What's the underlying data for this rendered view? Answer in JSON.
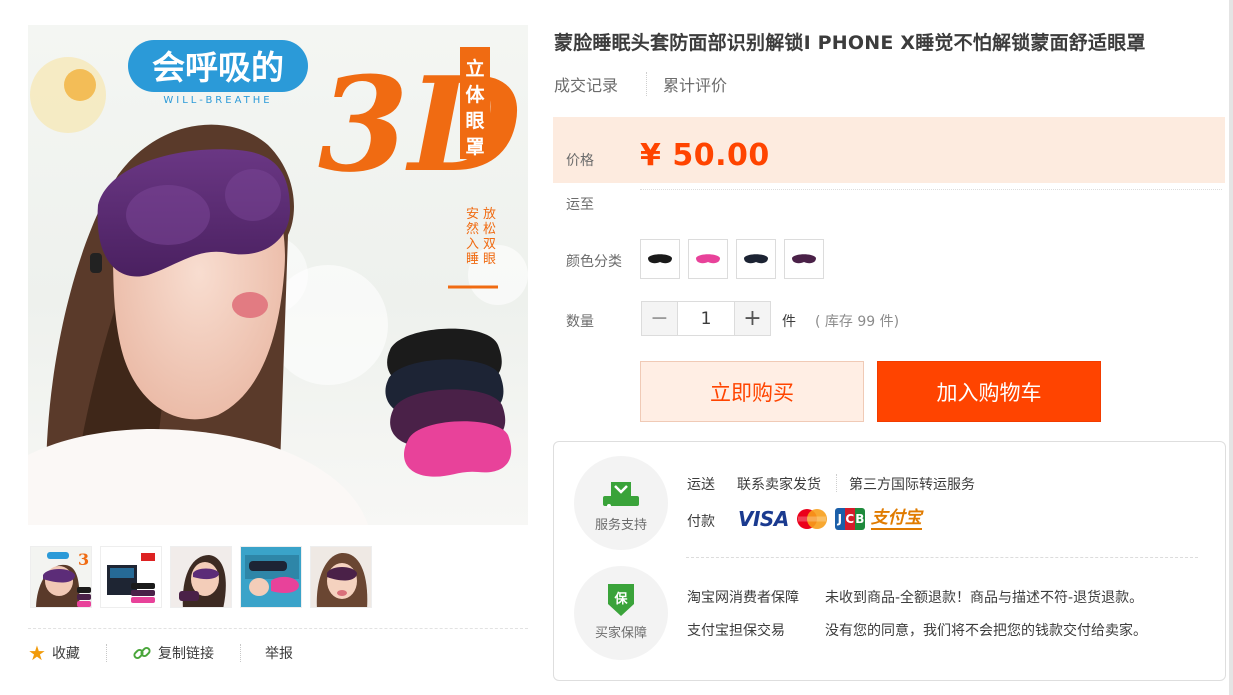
{
  "product": {
    "title": "蒙脸睡眠头套防面部识别解锁I PHONE X睡觉不怕解锁蒙面舒适眼罩",
    "meta_tabs": [
      "成交记录",
      "累计评价"
    ],
    "price_label": "价格",
    "price": "¥ 50.00",
    "shipping_label": "运至",
    "color_label": "颜色分类",
    "colors": [
      {
        "name": "black",
        "hex": "#1a1a1a"
      },
      {
        "name": "pink",
        "hex": "#e8429a"
      },
      {
        "name": "navy",
        "hex": "#1c2333"
      },
      {
        "name": "purple",
        "hex": "#4a2148"
      }
    ],
    "quantity_label": "数量",
    "quantity_value": "1",
    "quantity_unit": "件",
    "stock_text": "( 库存 99 件)",
    "buy_now": "立即购买",
    "add_to_cart": "加入购物车"
  },
  "main_image": {
    "headline": "会呼吸的",
    "subheadline": "WILL-BREATHE",
    "big_text": "3D",
    "side_banner": "立体眼罩",
    "side_small_1": "放松双眼",
    "side_small_2": "安然入睡"
  },
  "thumbnails": [
    "thumb-1",
    "thumb-2",
    "thumb-3",
    "thumb-4",
    "thumb-5"
  ],
  "left_actions": {
    "favorite": "收藏",
    "copy_link": "复制链接",
    "report": "举报"
  },
  "service": {
    "support_title": "服务支持",
    "shipping_label": "运送",
    "shipping_value": "联系卖家发货",
    "shipping_extra": "第三方国际转运服务",
    "payment_label": "付款",
    "payment_logos": [
      "VISA",
      "MasterCard",
      "JCB",
      "支付宝"
    ],
    "guarantee_title": "买家保障",
    "guarantee_icon_text": "保",
    "guarantee_rows": [
      {
        "label": "淘宝网消费者保障",
        "value": "未收到商品-全额退款！商品与描述不符-退货退款。"
      },
      {
        "label": "支付宝担保交易",
        "value": "没有您的同意，我们将不会把您的钱款交付给卖家。"
      }
    ]
  },
  "colors": {
    "accent": "#ff4400",
    "price_bg": "#fdebdf",
    "buy_bg": "#ffeee4"
  }
}
